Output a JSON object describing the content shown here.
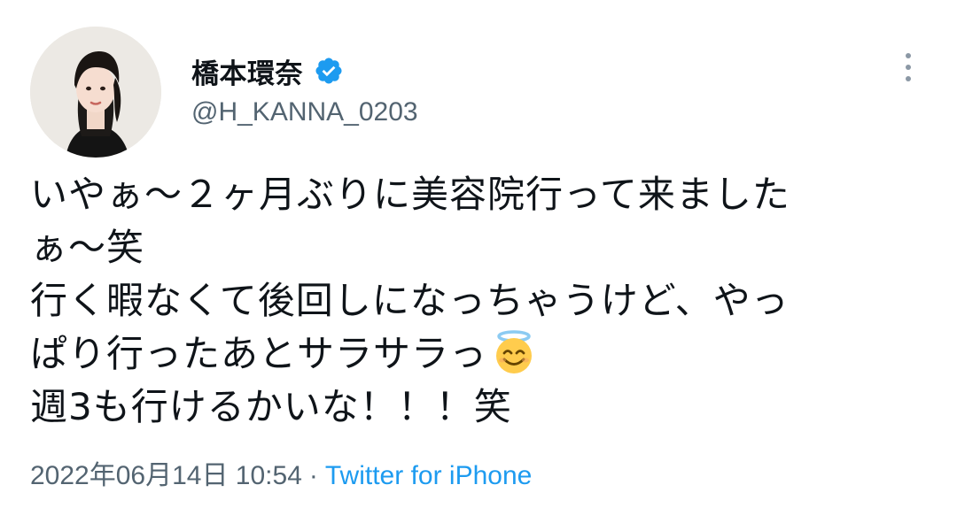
{
  "author": {
    "display_name": "橋本環奈",
    "handle": "@H_KANNA_0203",
    "verified": true
  },
  "tweet": {
    "lines": [
      "いやぁ〜２ヶ月ぶりに美容院行って来ました",
      "ぁ〜笑",
      "行く暇なくて後回しになっちゃうけど、やっ",
      "ぱり行ったあとサラサラっ",
      "週3も行けるかいな！！！笑"
    ],
    "emoji_after_line_4": "smiling-face-with-halo"
  },
  "meta": {
    "timestamp": "2022年06月14日 10:54",
    "separator": "·",
    "source": "Twitter for iPhone"
  },
  "colors": {
    "text": "#0f1419",
    "secondary": "#536471",
    "link": "#1d9bf0",
    "verified_badge": "#1d9bf0"
  }
}
